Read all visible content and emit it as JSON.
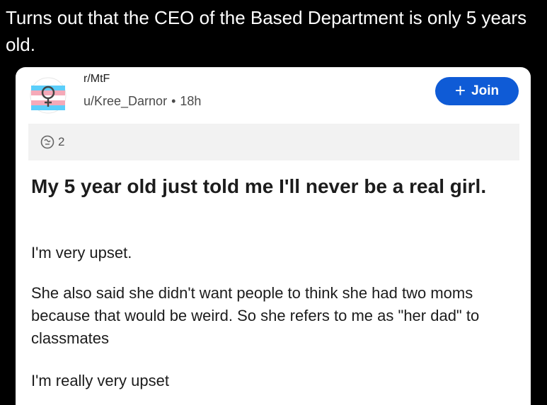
{
  "caption": "Turns out that the CEO of the Based Department is only 5 years old.",
  "post": {
    "subreddit": "r/MtF",
    "author": "u/Kree_Darnor",
    "separator": "•",
    "age": "18h",
    "join_label": "Join",
    "award_count": "2",
    "title": "My 5 year old just told me I'll never be a real girl.",
    "body": [
      "I'm very upset.",
      "She also said she didn't want people to think she had two moms because that would be weird. So she refers to me as \"her dad\" to classmates",
      "I'm really very upset"
    ]
  },
  "colors": {
    "join_button": "#0f5bd6",
    "avatar_pink": "#f5a9b8",
    "avatar_blue": "#5bcefa"
  },
  "icons": {
    "avatar": "transgender-flag-symbol-icon",
    "join": "plus-icon",
    "award": "award-icon"
  }
}
